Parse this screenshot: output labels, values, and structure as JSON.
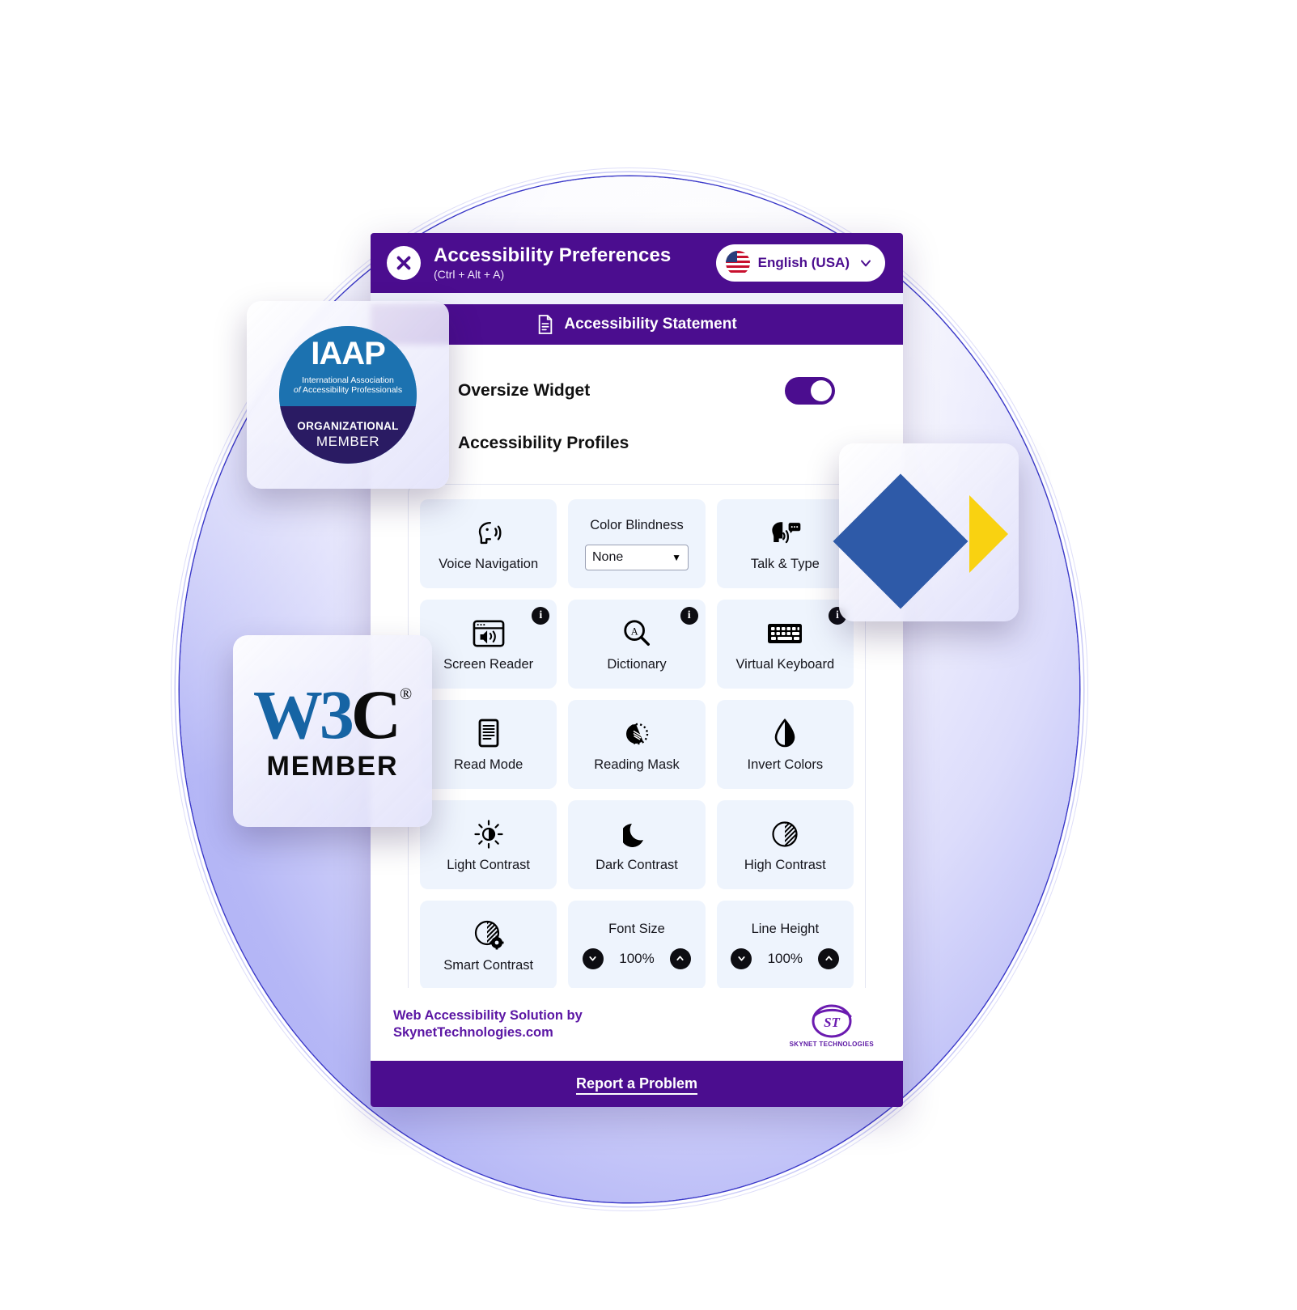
{
  "header": {
    "close_icon": "close-x-icon",
    "title": "Accessibility Preferences",
    "shortcut": "(Ctrl + Alt + A)",
    "language": {
      "flag_icon": "usa-flag-icon",
      "label": "English (USA)",
      "chevron_icon": "chevron-down-icon"
    }
  },
  "statement": {
    "icon": "document-icon",
    "label": "Accessibility Statement"
  },
  "settings": {
    "oversize_widget_label": "Oversize Widget",
    "oversize_widget_on": true,
    "profiles_label": "Accessibility Profiles"
  },
  "tiles": [
    {
      "kind": "icon",
      "label": "Voice Navigation",
      "icon": "speaking-head-icon",
      "info": false
    },
    {
      "kind": "select",
      "label": "Color Blindness",
      "value": "None",
      "caret": "caret-down-icon",
      "info": false
    },
    {
      "kind": "icon",
      "label": "Talk & Type",
      "icon": "talk-type-head-icon",
      "info": false
    },
    {
      "kind": "icon",
      "label": "Screen Reader",
      "icon": "screen-reader-icon",
      "info": true
    },
    {
      "kind": "icon",
      "label": "Dictionary",
      "icon": "dictionary-search-icon",
      "info": true
    },
    {
      "kind": "icon",
      "label": "Virtual Keyboard",
      "icon": "keyboard-icon",
      "info": true
    },
    {
      "kind": "icon",
      "label": "Read Mode",
      "icon": "read-mode-page-icon",
      "info": false
    },
    {
      "kind": "icon",
      "label": "Reading Mask",
      "icon": "reading-mask-icon",
      "info": false
    },
    {
      "kind": "icon",
      "label": "Invert Colors",
      "icon": "invert-colors-drop-icon",
      "info": false
    },
    {
      "kind": "icon",
      "label": "Light Contrast",
      "icon": "sun-icon",
      "info": false
    },
    {
      "kind": "icon",
      "label": "Dark Contrast",
      "icon": "moon-icon",
      "info": false
    },
    {
      "kind": "icon",
      "label": "High Contrast",
      "icon": "high-contrast-icon",
      "info": false
    },
    {
      "kind": "icon",
      "label": "Smart Contrast",
      "icon": "smart-contrast-gear-icon",
      "info": false
    },
    {
      "kind": "stepper",
      "label": "Font Size",
      "value": "100%",
      "dec_icon": "chevron-down-icon",
      "inc_icon": "chevron-up-icon"
    },
    {
      "kind": "stepper",
      "label": "Line Height",
      "value": "100%",
      "dec_icon": "chevron-down-icon",
      "inc_icon": "chevron-up-icon"
    }
  ],
  "footer": {
    "line1": "Web Accessibility Solution by",
    "line2": "SkynetTechnologies.com",
    "logo_mark": "ST",
    "logo_name": "SKYNET TECHNOLOGIES"
  },
  "report": {
    "label": "Report a Problem"
  },
  "badges": {
    "iaap": {
      "word": "IAAP",
      "line1": "International Association",
      "line2_italic": "of",
      "line2": "Accessibility Professionals",
      "org": "ORGANIZATIONAL",
      "member": "MEMBER"
    },
    "w3c": {
      "blue_part": "W3",
      "black_part": "C",
      "registered": "®",
      "member": "MEMBER"
    },
    "shapes": {
      "name": "blue-square-yellow-triangle-logo"
    }
  },
  "colors": {
    "brand_purple": "#4b0d8f",
    "tile_blue": "#eef4fd",
    "iaap_blue": "#1c72b0",
    "iaap_navy": "#2a1b63",
    "w3c_blue": "#1664a4",
    "shape_blue": "#2e5aa8",
    "shape_yellow": "#f9d211"
  }
}
